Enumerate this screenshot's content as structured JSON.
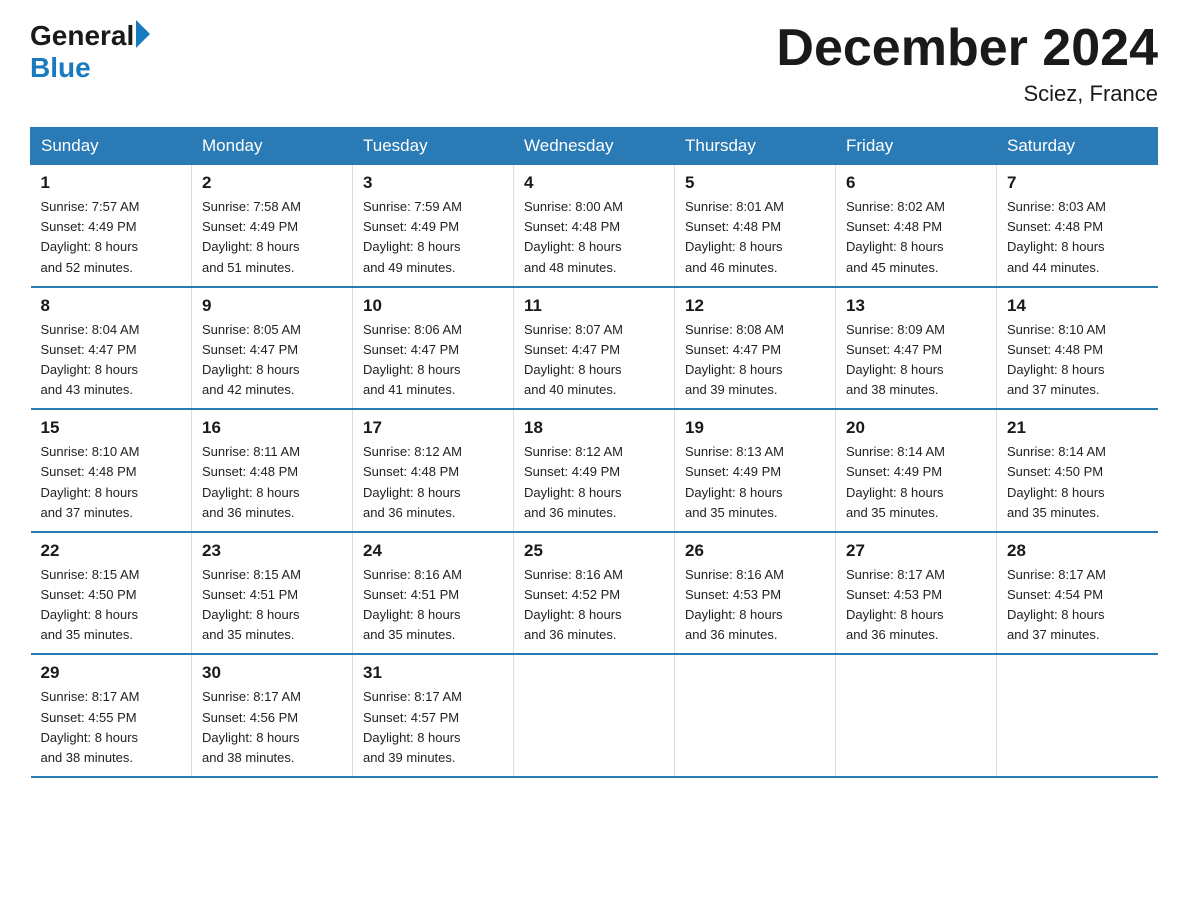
{
  "header": {
    "logo_general": "General",
    "logo_blue": "Blue",
    "title": "December 2024",
    "subtitle": "Sciez, France"
  },
  "days_of_week": [
    "Sunday",
    "Monday",
    "Tuesday",
    "Wednesday",
    "Thursday",
    "Friday",
    "Saturday"
  ],
  "weeks": [
    [
      {
        "date": "1",
        "sunrise": "7:57 AM",
        "sunset": "4:49 PM",
        "daylight": "8 hours and 52 minutes."
      },
      {
        "date": "2",
        "sunrise": "7:58 AM",
        "sunset": "4:49 PM",
        "daylight": "8 hours and 51 minutes."
      },
      {
        "date": "3",
        "sunrise": "7:59 AM",
        "sunset": "4:49 PM",
        "daylight": "8 hours and 49 minutes."
      },
      {
        "date": "4",
        "sunrise": "8:00 AM",
        "sunset": "4:48 PM",
        "daylight": "8 hours and 48 minutes."
      },
      {
        "date": "5",
        "sunrise": "8:01 AM",
        "sunset": "4:48 PM",
        "daylight": "8 hours and 46 minutes."
      },
      {
        "date": "6",
        "sunrise": "8:02 AM",
        "sunset": "4:48 PM",
        "daylight": "8 hours and 45 minutes."
      },
      {
        "date": "7",
        "sunrise": "8:03 AM",
        "sunset": "4:48 PM",
        "daylight": "8 hours and 44 minutes."
      }
    ],
    [
      {
        "date": "8",
        "sunrise": "8:04 AM",
        "sunset": "4:47 PM",
        "daylight": "8 hours and 43 minutes."
      },
      {
        "date": "9",
        "sunrise": "8:05 AM",
        "sunset": "4:47 PM",
        "daylight": "8 hours and 42 minutes."
      },
      {
        "date": "10",
        "sunrise": "8:06 AM",
        "sunset": "4:47 PM",
        "daylight": "8 hours and 41 minutes."
      },
      {
        "date": "11",
        "sunrise": "8:07 AM",
        "sunset": "4:47 PM",
        "daylight": "8 hours and 40 minutes."
      },
      {
        "date": "12",
        "sunrise": "8:08 AM",
        "sunset": "4:47 PM",
        "daylight": "8 hours and 39 minutes."
      },
      {
        "date": "13",
        "sunrise": "8:09 AM",
        "sunset": "4:47 PM",
        "daylight": "8 hours and 38 minutes."
      },
      {
        "date": "14",
        "sunrise": "8:10 AM",
        "sunset": "4:48 PM",
        "daylight": "8 hours and 37 minutes."
      }
    ],
    [
      {
        "date": "15",
        "sunrise": "8:10 AM",
        "sunset": "4:48 PM",
        "daylight": "8 hours and 37 minutes."
      },
      {
        "date": "16",
        "sunrise": "8:11 AM",
        "sunset": "4:48 PM",
        "daylight": "8 hours and 36 minutes."
      },
      {
        "date": "17",
        "sunrise": "8:12 AM",
        "sunset": "4:48 PM",
        "daylight": "8 hours and 36 minutes."
      },
      {
        "date": "18",
        "sunrise": "8:12 AM",
        "sunset": "4:49 PM",
        "daylight": "8 hours and 36 minutes."
      },
      {
        "date": "19",
        "sunrise": "8:13 AM",
        "sunset": "4:49 PM",
        "daylight": "8 hours and 35 minutes."
      },
      {
        "date": "20",
        "sunrise": "8:14 AM",
        "sunset": "4:49 PM",
        "daylight": "8 hours and 35 minutes."
      },
      {
        "date": "21",
        "sunrise": "8:14 AM",
        "sunset": "4:50 PM",
        "daylight": "8 hours and 35 minutes."
      }
    ],
    [
      {
        "date": "22",
        "sunrise": "8:15 AM",
        "sunset": "4:50 PM",
        "daylight": "8 hours and 35 minutes."
      },
      {
        "date": "23",
        "sunrise": "8:15 AM",
        "sunset": "4:51 PM",
        "daylight": "8 hours and 35 minutes."
      },
      {
        "date": "24",
        "sunrise": "8:16 AM",
        "sunset": "4:51 PM",
        "daylight": "8 hours and 35 minutes."
      },
      {
        "date": "25",
        "sunrise": "8:16 AM",
        "sunset": "4:52 PM",
        "daylight": "8 hours and 36 minutes."
      },
      {
        "date": "26",
        "sunrise": "8:16 AM",
        "sunset": "4:53 PM",
        "daylight": "8 hours and 36 minutes."
      },
      {
        "date": "27",
        "sunrise": "8:17 AM",
        "sunset": "4:53 PM",
        "daylight": "8 hours and 36 minutes."
      },
      {
        "date": "28",
        "sunrise": "8:17 AM",
        "sunset": "4:54 PM",
        "daylight": "8 hours and 37 minutes."
      }
    ],
    [
      {
        "date": "29",
        "sunrise": "8:17 AM",
        "sunset": "4:55 PM",
        "daylight": "8 hours and 38 minutes."
      },
      {
        "date": "30",
        "sunrise": "8:17 AM",
        "sunset": "4:56 PM",
        "daylight": "8 hours and 38 minutes."
      },
      {
        "date": "31",
        "sunrise": "8:17 AM",
        "sunset": "4:57 PM",
        "daylight": "8 hours and 39 minutes."
      },
      null,
      null,
      null,
      null
    ]
  ]
}
